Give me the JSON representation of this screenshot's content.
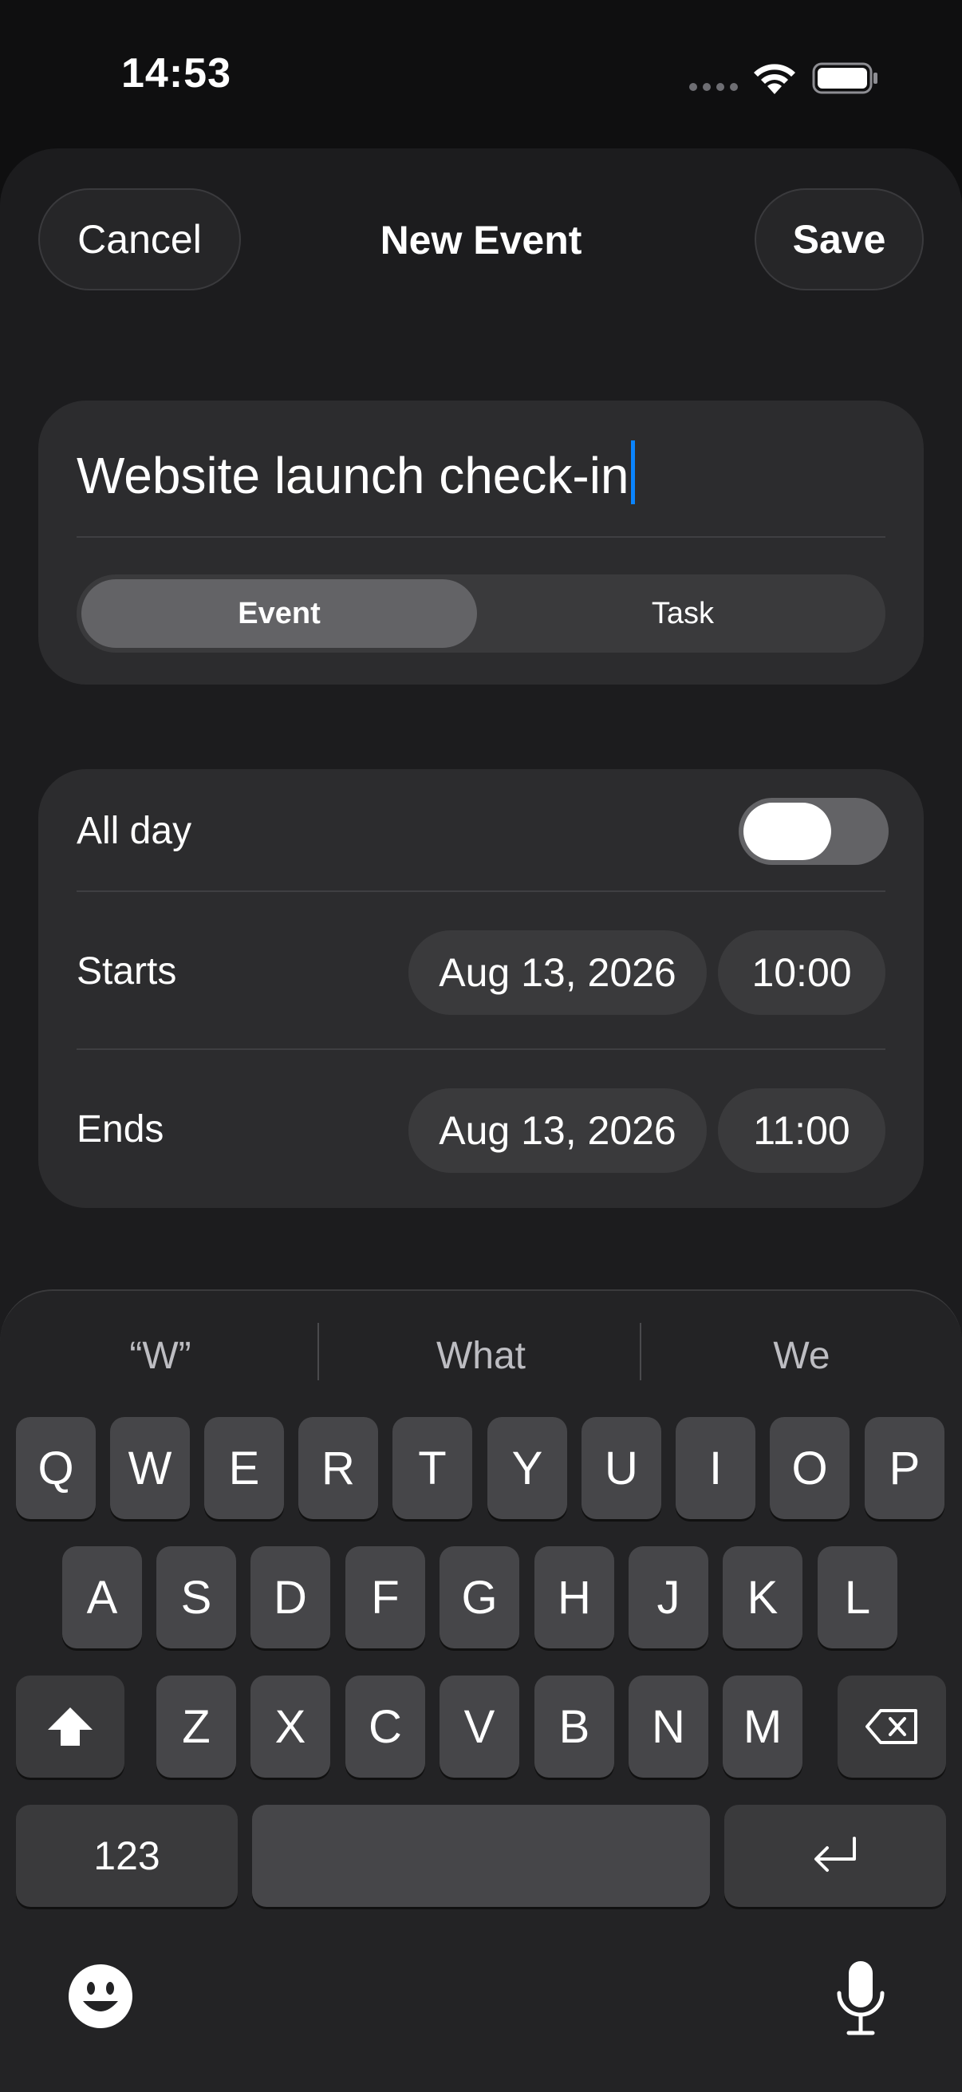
{
  "status_bar": {
    "time": "14:53",
    "icons": [
      "signal-dots-icon",
      "wifi-icon",
      "battery-icon"
    ]
  },
  "nav": {
    "cancel_label": "Cancel",
    "title": "New Event",
    "save_label": "Save"
  },
  "event_title": {
    "value": "Website launch check-in"
  },
  "segment": {
    "options": [
      "Event",
      "Task"
    ],
    "selected": "Event"
  },
  "schedule": {
    "all_day_label": "All day",
    "all_day_on": false,
    "starts_label": "Starts",
    "starts_date": "Aug 13, 2026",
    "starts_time": "10:00",
    "ends_label": "Ends",
    "ends_date": "Aug 13, 2026",
    "ends_time": "11:00"
  },
  "keyboard": {
    "suggestions": [
      "“W”",
      "What",
      "We"
    ],
    "row1": [
      "Q",
      "W",
      "E",
      "R",
      "T",
      "Y",
      "U",
      "I",
      "O",
      "P"
    ],
    "row2": [
      "A",
      "S",
      "D",
      "F",
      "G",
      "H",
      "J",
      "K",
      "L"
    ],
    "row3": [
      "Z",
      "X",
      "C",
      "V",
      "B",
      "N",
      "M"
    ],
    "numbers_label": "123",
    "icons": [
      "shift-icon",
      "backspace-icon",
      "return-icon",
      "emoji-icon",
      "microphone-icon"
    ]
  },
  "colors": {
    "accent_caret": "#0a84ff",
    "sheet": "#1c1c1e",
    "card": "#2c2c2e"
  }
}
